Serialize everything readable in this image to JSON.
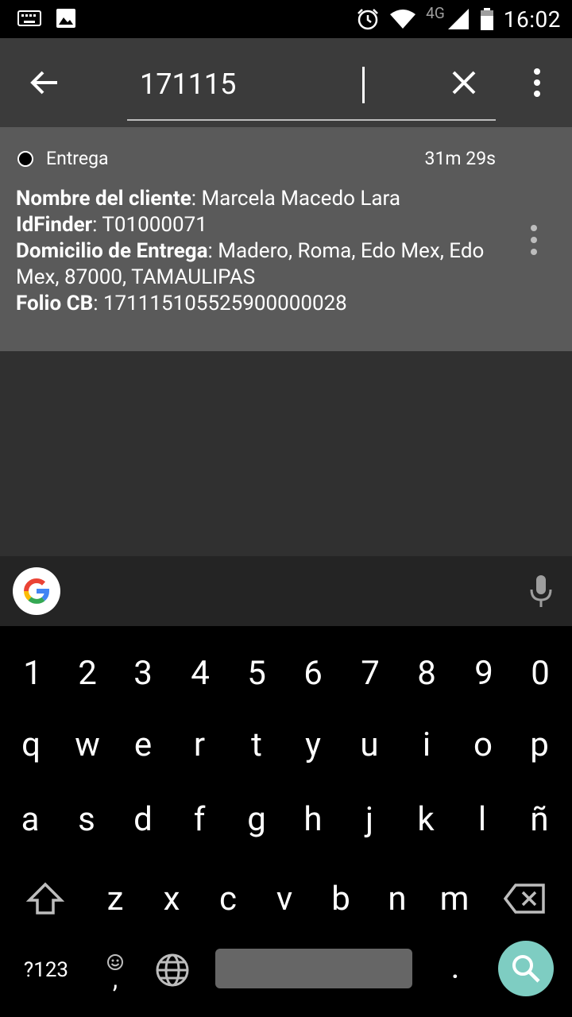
{
  "status_bar": {
    "time": "16:02",
    "network_label": "4G",
    "icons": [
      "keyboard-icon",
      "image-icon",
      "alarm-icon",
      "wifi-icon",
      "signal-icon",
      "battery-icon"
    ]
  },
  "search": {
    "query": "171115",
    "icons": [
      "arrow-back-icon",
      "close-icon",
      "more-vert-icon"
    ]
  },
  "result": {
    "status": "Entrega",
    "elapsed": "31m 29s",
    "fields": [
      {
        "label": "Nombre del cliente",
        "sep": ": ",
        "value": "Marcela Macedo Lara"
      },
      {
        "label": "IdFinder",
        "sep": ": ",
        "value": "T01000071"
      },
      {
        "label": "Domicilio de Entrega",
        "sep": ": ",
        "value": "Madero, Roma, Edo Mex, Edo Mex, 87000, TAMAULIPAS"
      },
      {
        "label": "Folio CB",
        "sep": ": ",
        "value": "171115105525900000028"
      }
    ]
  },
  "keyboard": {
    "row_numbers": [
      "1",
      "2",
      "3",
      "4",
      "5",
      "6",
      "7",
      "8",
      "9",
      "0"
    ],
    "row_top": [
      "q",
      "w",
      "e",
      "r",
      "t",
      "y",
      "u",
      "i",
      "o",
      "p"
    ],
    "row_middle": [
      "a",
      "s",
      "d",
      "f",
      "g",
      "h",
      "j",
      "k",
      "l",
      "ñ"
    ],
    "row_bottom": [
      "z",
      "x",
      "c",
      "v",
      "b",
      "n",
      "m"
    ],
    "symbols_label": "?123",
    "comma_label": ",",
    "period_label": ".",
    "accent_color": "#7ecdc2"
  }
}
